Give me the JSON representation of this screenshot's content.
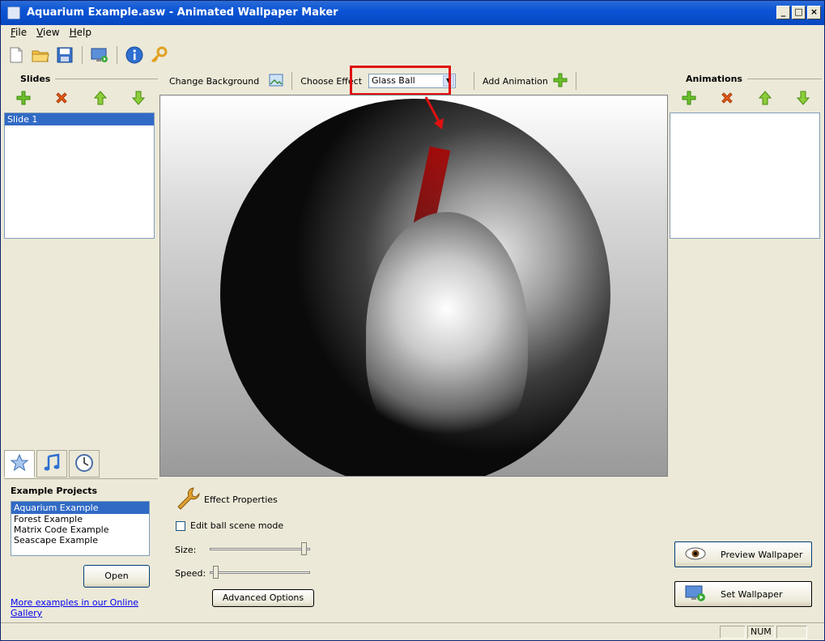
{
  "window": {
    "title": "Aquarium Example.asw - Animated Wallpaper Maker"
  },
  "menu": {
    "items": [
      {
        "ul": "F",
        "rest": "ile"
      },
      {
        "ul": "V",
        "rest": "iew"
      },
      {
        "ul": "H",
        "rest": "elp"
      }
    ]
  },
  "toolbar": {
    "icons": [
      "new-file-icon",
      "open-folder-icon",
      "save-icon",
      "set-wallpaper-icon",
      "info-icon",
      "key-icon"
    ]
  },
  "slides": {
    "title": "Slides",
    "items": [
      "Slide 1"
    ],
    "selected_index": 0
  },
  "center": {
    "change_background_label": "Change Background",
    "choose_effect_label": "Choose Effect",
    "effect_value": "Glass Ball",
    "add_animation_label": "Add Animation"
  },
  "animations": {
    "title": "Animations",
    "items": []
  },
  "examples": {
    "title": "Example Projects",
    "items": [
      "Aquarium Example",
      "Forest Example",
      "Matrix Code Example",
      "Seascape Example"
    ],
    "selected_index": 0,
    "open_label": "Open",
    "gallery_link": "More examples in our Online Gallery"
  },
  "effect_properties": {
    "title": "Effect Properties",
    "edit_ball_label": "Edit ball scene mode",
    "size_label": "Size:",
    "speed_label": "Speed:",
    "size_value_fraction": 0.97,
    "speed_value_fraction": 0.03,
    "advanced_label": "Advanced Options"
  },
  "actions": {
    "preview_label": "Preview Wallpaper",
    "set_label": "Set Wallpaper"
  },
  "status": {
    "num": "NUM"
  },
  "colors": {
    "accent_highlight": "#e01010",
    "selection": "#316ac5",
    "titlebar": "#0a54d6"
  }
}
